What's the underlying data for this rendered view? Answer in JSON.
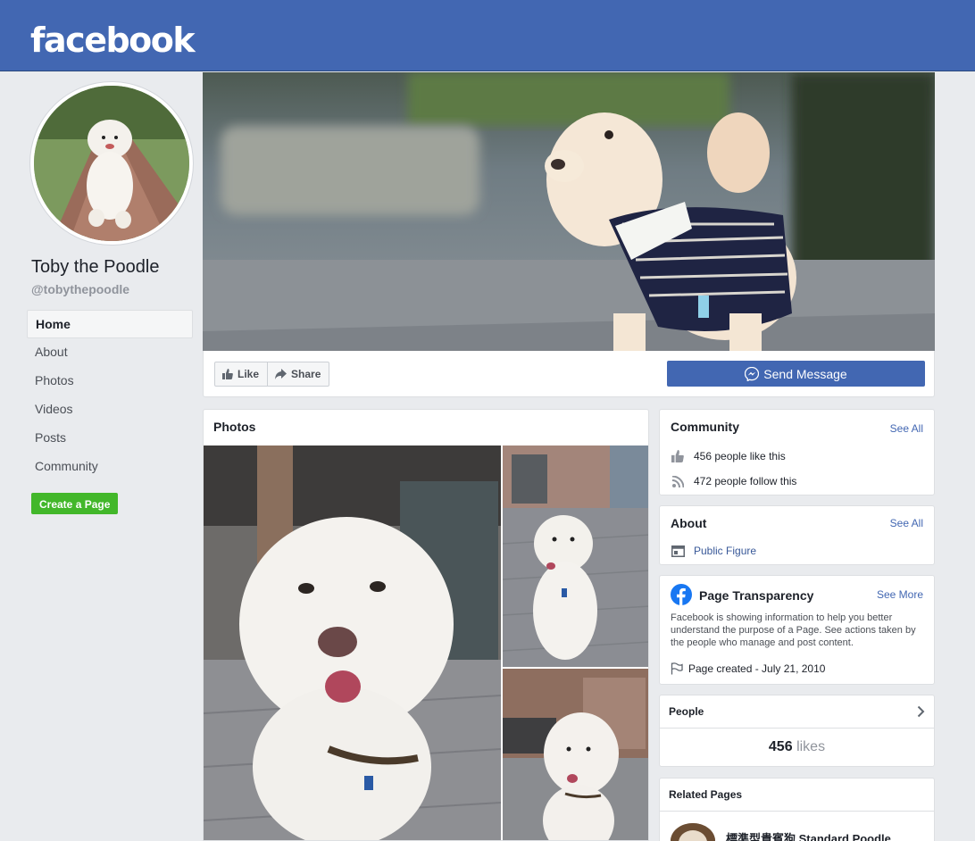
{
  "header": {
    "logo_text": "facebook",
    "brand_color": "#4267b2"
  },
  "profile": {
    "name": "Toby the Poodle",
    "handle": "@tobythepoodle",
    "avatar_icon": "poodle-avatar"
  },
  "nav": {
    "items": [
      {
        "label": "Home",
        "active": true
      },
      {
        "label": "About"
      },
      {
        "label": "Photos"
      },
      {
        "label": "Videos"
      },
      {
        "label": "Posts"
      },
      {
        "label": "Community"
      }
    ],
    "create_page_label": "Create a Page"
  },
  "actions": {
    "like_label": "Like",
    "share_label": "Share",
    "send_message_label": "Send Message"
  },
  "photos": {
    "title": "Photos"
  },
  "community": {
    "title": "Community",
    "see_all": "See All",
    "likes_text": "456 people like this",
    "follows_text": "472 people follow this"
  },
  "about": {
    "title": "About",
    "see_all": "See All",
    "category": "Public Figure"
  },
  "transparency": {
    "title": "Page Transparency",
    "see_more": "See More",
    "description": "Facebook is showing information to help you better understand the purpose of a Page. See actions taken by the people who manage and post content.",
    "created_text": "Page created - July 21, 2010"
  },
  "people": {
    "title": "People",
    "likes_count": "456",
    "likes_unit": "likes"
  },
  "related": {
    "title": "Related Pages",
    "first_page_name": "標準型貴賓狗 Standard Poodle ..."
  }
}
